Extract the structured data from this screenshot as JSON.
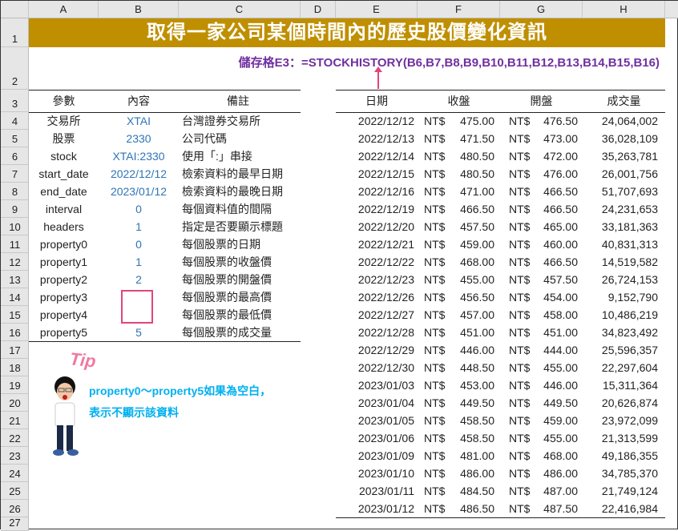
{
  "columns": [
    "A",
    "B",
    "C",
    "D",
    "E",
    "F",
    "G",
    "H"
  ],
  "rows": [
    "1",
    "2",
    "3",
    "4",
    "5",
    "6",
    "7",
    "8",
    "9",
    "10",
    "11",
    "12",
    "13",
    "14",
    "15",
    "16",
    "17",
    "18",
    "19",
    "20",
    "21",
    "22",
    "23",
    "24",
    "25",
    "26",
    "27"
  ],
  "title": "取得一家公司某個時間內的歷史股價變化資訊",
  "formula": "儲存格E3：=STOCKHISTORY(B6,B7,B8,B9,B10,B11,B12,B13,B14,B15,B16)",
  "params": {
    "headers": [
      "參數",
      "內容",
      "備註"
    ],
    "rows": [
      [
        "交易所",
        "XTAI",
        "台灣證券交易所"
      ],
      [
        "股票",
        "2330",
        "公司代碼"
      ],
      [
        "stock",
        "XTAI:2330",
        "使用「:」串接"
      ],
      [
        "start_date",
        "2022/12/12",
        "檢索資料的最早日期"
      ],
      [
        "end_date",
        "2023/01/12",
        "檢索資料的最晚日期"
      ],
      [
        "interval",
        "0",
        "每個資料值的間隔"
      ],
      [
        "headers",
        "1",
        "指定是否要顯示標題"
      ],
      [
        "property0",
        "0",
        "每個股票的日期"
      ],
      [
        "property1",
        "1",
        "每個股票的收盤價"
      ],
      [
        "property2",
        "2",
        "每個股票的開盤價"
      ],
      [
        "property3",
        "",
        "每個股票的最高價"
      ],
      [
        "property4",
        "",
        "每個股票的最低價"
      ],
      [
        "property5",
        "5",
        "每個股票的成交量"
      ]
    ]
  },
  "stock": {
    "headers": [
      "日期",
      "收盤",
      "開盤",
      "成交量"
    ],
    "rows": [
      [
        "2022/12/12",
        "NT$",
        "475.00",
        "NT$",
        "476.50",
        "24,064,002"
      ],
      [
        "2022/12/13",
        "NT$",
        "471.50",
        "NT$",
        "473.00",
        "36,028,109"
      ],
      [
        "2022/12/14",
        "NT$",
        "480.50",
        "NT$",
        "472.00",
        "35,263,781"
      ],
      [
        "2022/12/15",
        "NT$",
        "480.50",
        "NT$",
        "476.00",
        "26,001,756"
      ],
      [
        "2022/12/16",
        "NT$",
        "471.00",
        "NT$",
        "466.50",
        "51,707,693"
      ],
      [
        "2022/12/19",
        "NT$",
        "466.50",
        "NT$",
        "466.50",
        "24,231,653"
      ],
      [
        "2022/12/20",
        "NT$",
        "457.50",
        "NT$",
        "465.00",
        "33,181,363"
      ],
      [
        "2022/12/21",
        "NT$",
        "459.00",
        "NT$",
        "460.00",
        "40,831,313"
      ],
      [
        "2022/12/22",
        "NT$",
        "468.00",
        "NT$",
        "466.50",
        "14,519,582"
      ],
      [
        "2022/12/23",
        "NT$",
        "455.00",
        "NT$",
        "457.50",
        "26,724,153"
      ],
      [
        "2022/12/26",
        "NT$",
        "456.50",
        "NT$",
        "454.00",
        "9,152,790"
      ],
      [
        "2022/12/27",
        "NT$",
        "457.00",
        "NT$",
        "458.00",
        "10,486,219"
      ],
      [
        "2022/12/28",
        "NT$",
        "451.00",
        "NT$",
        "451.00",
        "34,823,492"
      ],
      [
        "2022/12/29",
        "NT$",
        "446.00",
        "NT$",
        "444.00",
        "25,596,357"
      ],
      [
        "2022/12/30",
        "NT$",
        "448.50",
        "NT$",
        "455.00",
        "22,297,604"
      ],
      [
        "2023/01/03",
        "NT$",
        "453.00",
        "NT$",
        "446.00",
        "15,311,364"
      ],
      [
        "2023/01/04",
        "NT$",
        "449.50",
        "NT$",
        "449.50",
        "20,626,874"
      ],
      [
        "2023/01/05",
        "NT$",
        "458.50",
        "NT$",
        "459.00",
        "23,972,099"
      ],
      [
        "2023/01/06",
        "NT$",
        "458.50",
        "NT$",
        "455.00",
        "21,313,599"
      ],
      [
        "2023/01/09",
        "NT$",
        "481.00",
        "NT$",
        "468.00",
        "49,186,355"
      ],
      [
        "2023/01/10",
        "NT$",
        "486.00",
        "NT$",
        "486.00",
        "34,785,370"
      ],
      [
        "2023/01/11",
        "NT$",
        "484.50",
        "NT$",
        "487.00",
        "21,749,124"
      ],
      [
        "2023/01/12",
        "NT$",
        "486.50",
        "NT$",
        "487.50",
        "22,416,984"
      ]
    ]
  },
  "tip": {
    "label": "Tip",
    "line1": "property0～property5如果為空白，",
    "line2": "表示不顯示該資料"
  }
}
